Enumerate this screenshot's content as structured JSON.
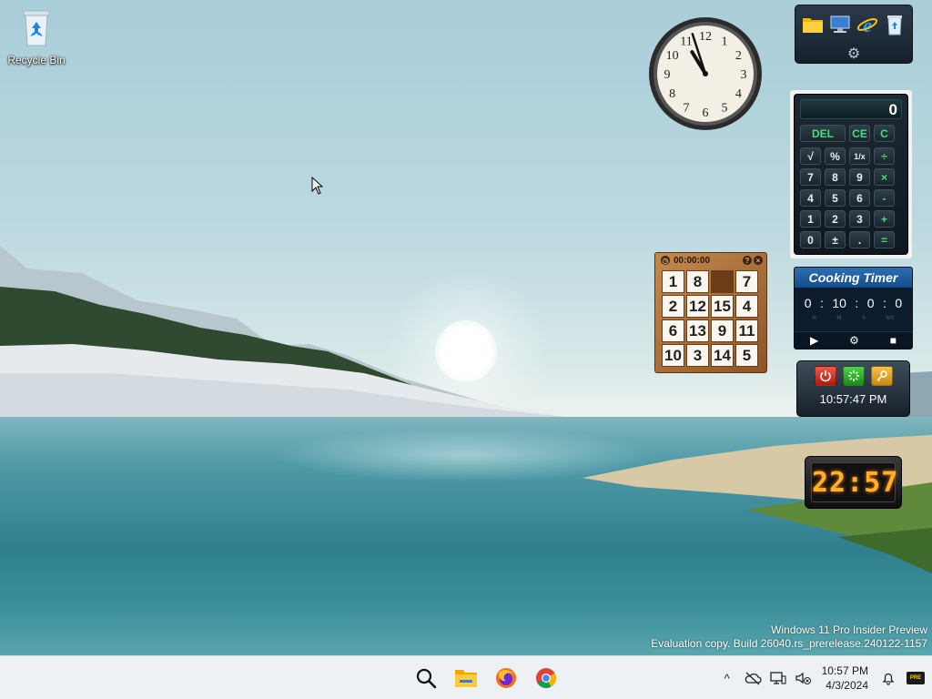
{
  "desktop": {
    "icons": [
      {
        "label": "Recycle Bin",
        "icon": "recycle-bin-icon"
      }
    ],
    "watermark": {
      "line1": "Windows 11 Pro Insider Preview",
      "line2": "Evaluation copy. Build 26040.rs_prerelease.240122-1157"
    }
  },
  "gadgets": {
    "analog_clock": {
      "numbers": [
        "12",
        "1",
        "2",
        "3",
        "4",
        "5",
        "6",
        "7",
        "8",
        "9",
        "10",
        "11"
      ],
      "hour": 10,
      "minute": 57
    },
    "launcher": {
      "icons": [
        "folder-icon",
        "computer-icon",
        "internet-explorer-icon",
        "recycle-bin-icon"
      ],
      "settings_glyph": "⚙"
    },
    "calculator": {
      "display": "0",
      "top_keys": [
        "DEL",
        "CE",
        "C"
      ],
      "keys": [
        "√",
        "%",
        "1/x",
        "÷",
        "7",
        "8",
        "9",
        "×",
        "4",
        "5",
        "6",
        "-",
        "1",
        "2",
        "3",
        "+",
        "0",
        "±",
        ".",
        "="
      ]
    },
    "puzzle": {
      "timer": "00:00:00",
      "help_glyph": "?",
      "close_glyph": "×",
      "tiles": [
        "1",
        "8",
        "",
        "7",
        "2",
        "12",
        "15",
        "4",
        "6",
        "13",
        "9",
        "11",
        "10",
        "3",
        "14",
        "5"
      ]
    },
    "cooking_timer": {
      "title": "Cooking Timer",
      "hours": "0",
      "minutes": "10",
      "seconds": "0",
      "ms": "0",
      "sep": ":",
      "units": [
        "H",
        "M",
        "S",
        "MS"
      ],
      "play_glyph": "▶",
      "settings_glyph": "⚙",
      "stop_glyph": "■"
    },
    "shutdown": {
      "time": "10:57:47 PM",
      "buttons": [
        "power-icon",
        "restart-icon",
        "key-icon"
      ]
    },
    "digital_clock": {
      "time": "22:57"
    }
  },
  "taskbar": {
    "apps": [
      "search-icon",
      "file-explorer-icon",
      "firefox-icon",
      "chrome-icon"
    ],
    "tray": {
      "chevron": "^",
      "time": "10:57 PM",
      "date": "4/3/2024",
      "badge": "PRE"
    }
  },
  "colors": {
    "taskbar_bg": "#eef1f4",
    "calc_green": "#3fe07a",
    "digital_amber": "#ffb02a"
  }
}
